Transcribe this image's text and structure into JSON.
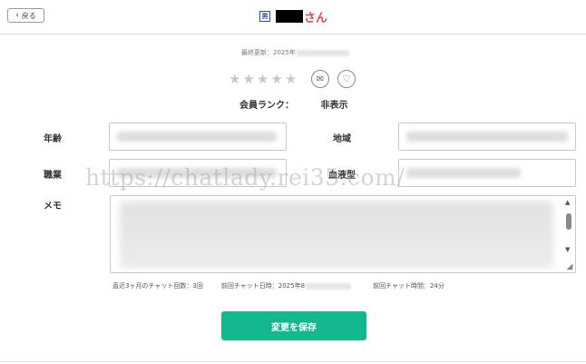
{
  "header": {
    "back_label": "戻る",
    "title_badge": "男",
    "title_suffix": "さん"
  },
  "profile": {
    "last_updated": "最終更新：2025年",
    "rank_label": "会員ランク：",
    "rank_value": "非表示",
    "stars": [
      "★",
      "★",
      "★",
      "★",
      "★"
    ],
    "mail_icon_glyph": "✉",
    "heart_icon_glyph": "♡"
  },
  "form": {
    "age_label": "年齢",
    "region_label": "地域",
    "job_label": "職業",
    "blood_label": "血液型",
    "memo_label": "メモ"
  },
  "stats": {
    "chat_count": "直近3ヶ月のチャット回数：3回",
    "last_chat_date": "前回チャット日時：2025年8",
    "last_chat_duration": "前回チャット時間：24分"
  },
  "actions": {
    "save_label": "変更を保存"
  },
  "watermark": "https://chatlady.rei35.com/",
  "colors": {
    "accent": "#14b88f",
    "title_red": "#e04a4a",
    "badge_blue": "#2c4aa8"
  }
}
